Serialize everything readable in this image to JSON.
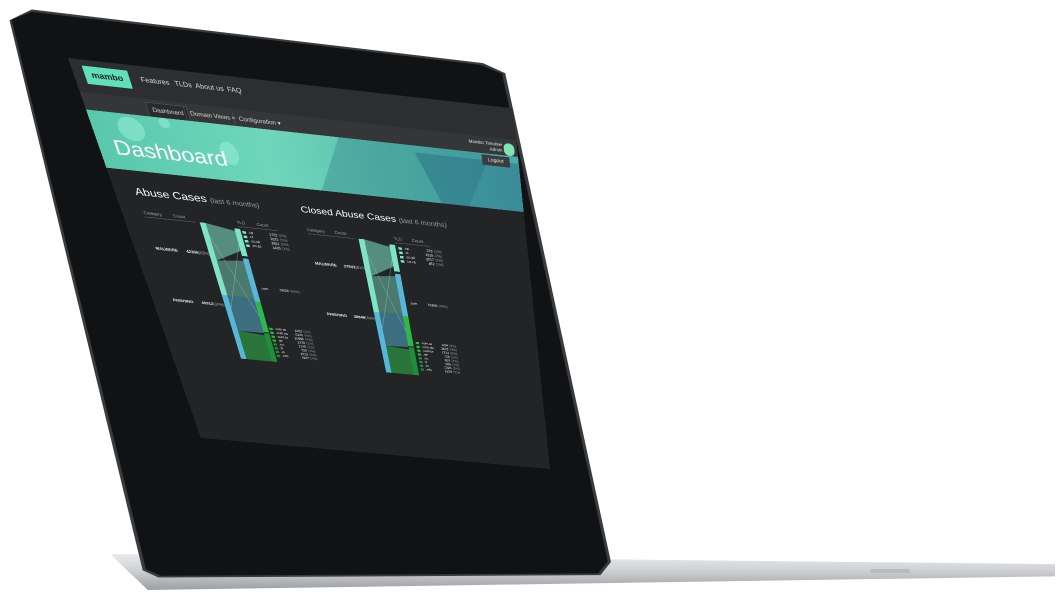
{
  "brand": {
    "logo": "mambo"
  },
  "nav": {
    "links": [
      "Features",
      "TLDs",
      "About us",
      "FAQ"
    ]
  },
  "subnav": {
    "tabs": [
      "Dashboard",
      "Domain Views ▾",
      "Configuration ▾"
    ],
    "active": 0
  },
  "user": {
    "name": "Mambo Timeline",
    "role": "Admin",
    "logout": "Logout"
  },
  "page": {
    "title": "Dashboard"
  },
  "colors": {
    "accent": "#5fe0b8",
    "malware": "#7fe3c6",
    "phishing": "#56b7d8",
    "green": "#2fb84a",
    "dark_green": "#1d8f3a"
  },
  "panels": [
    {
      "title": "Abuse Cases",
      "subtitle": "(last 6 months)",
      "headers": {
        "category": "Category",
        "count": "Count",
        "tld": "TLD",
        "tld_count": "Count"
      },
      "categories": [
        {
          "name": "MALWARE",
          "count": "42306",
          "pct": "(53%)"
        },
        {
          "name": "PHISHING",
          "count": "40913",
          "pct": "(32%)"
        }
      ],
      "top_tlds": [
        {
          "tld": ".ca",
          "count": "1722",
          "pct": "(1%)"
        },
        {
          "tld": ".cl",
          "count": "2022",
          "pct": "(1%)"
        },
        {
          "tld": ".co.uk",
          "count": "2861",
          "pct": "(2%)"
        },
        {
          "tld": ".co.za",
          "count": "1439",
          "pct": "(1%)"
        }
      ],
      "main_tld": {
        "tld": ".com",
        "count": "73026",
        "pct": "(58%)"
      },
      "bottom_tlds": [
        {
          "tld": ".com.ar",
          "count": "1102",
          "pct": "(1%)"
        },
        {
          "tld": ".com.au",
          "count": "5136",
          "pct": "(4%)"
        },
        {
          "tld": ".com.br",
          "count": "10986",
          "pct": "(9%)"
        },
        {
          "tld": ".de",
          "count": "1376",
          "pct": "(1%)"
        },
        {
          "tld": ".eu",
          "count": "1745",
          "pct": "(1%)"
        },
        {
          "tld": ".fr",
          "count": "728",
          "pct": "(1%)"
        },
        {
          "tld": ".in",
          "count": "2112",
          "pct": "(2%)"
        },
        {
          "tld": ".info",
          "count": "1947",
          "pct": "(2%)"
        }
      ]
    },
    {
      "title": "Closed Abuse Cases",
      "subtitle": "(last 6 months)",
      "headers": {
        "category": "Category",
        "count": "Count",
        "tld": "TLD",
        "tld_count": "Count"
      },
      "categories": [
        {
          "name": "MALWARE",
          "count": "37643",
          "pct": "(61%)"
        },
        {
          "name": "PHISHING",
          "count": "38649",
          "pct": "(33%)"
        }
      ],
      "top_tlds": [
        {
          "tld": ".ca",
          "count": "578",
          "pct": "(1%)"
        },
        {
          "tld": ".cl",
          "count": "1315",
          "pct": "(2%)"
        },
        {
          "tld": ".co.uk",
          "count": "2017",
          "pct": "(3%)"
        },
        {
          "tld": ".co.za",
          "count": "852",
          "pct": "(1%)"
        }
      ],
      "main_tld": {
        "tld": ".com",
        "count": "51860",
        "pct": "(59%)"
      },
      "bottom_tlds": [
        {
          "tld": ".com.ar",
          "count": "624",
          "pct": "(1%)"
        },
        {
          "tld": ".com.au",
          "count": "3478",
          "pct": "(4%)"
        },
        {
          "tld": ".com.br",
          "count": "7374",
          "pct": "(8%)"
        },
        {
          "tld": ".de",
          "count": "735",
          "pct": "(1%)"
        },
        {
          "tld": ".eu",
          "count": "592",
          "pct": "(1%)"
        },
        {
          "tld": ".fr",
          "count": "505",
          "pct": "(1%)"
        },
        {
          "tld": ".in",
          "count": "1326",
          "pct": "(2%)"
        },
        {
          "tld": ".info",
          "count": "1328",
          "pct": "(2%)"
        }
      ]
    }
  ]
}
